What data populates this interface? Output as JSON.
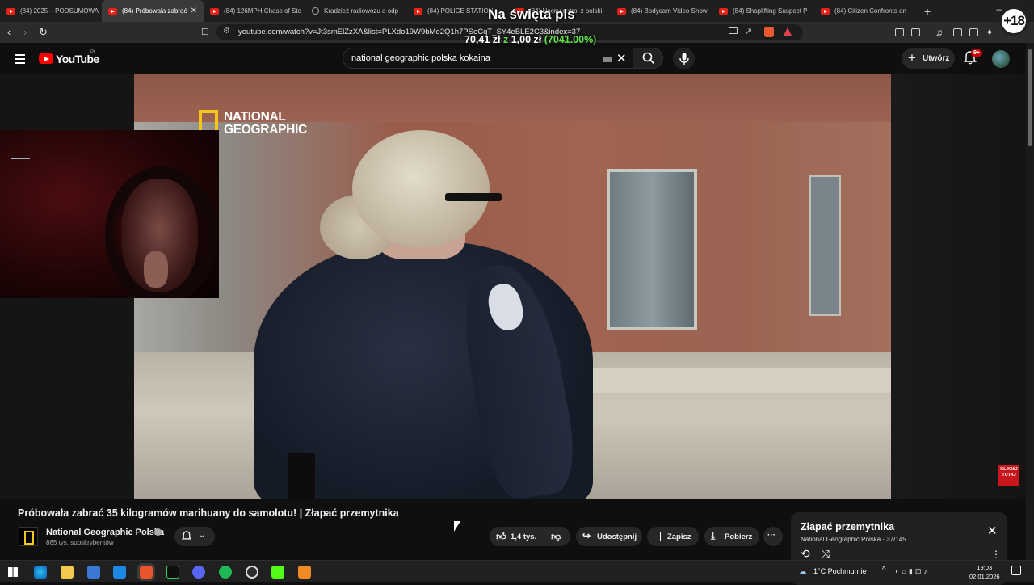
{
  "browser": {
    "tabs": [
      {
        "label": "(84) 2025 – PODSUMOWA",
        "icon": "youtube-icon",
        "active": false
      },
      {
        "label": "(84) Próbowała zabrać",
        "icon": "youtube-icon",
        "active": true
      },
      {
        "label": "(84) 126MPH Chase of Sto",
        "icon": "youtube-icon",
        "active": false
      },
      {
        "label": "Kradzież radiowozu a odp",
        "icon": "globe-icon",
        "active": false
      },
      {
        "label": "(84) POLICE STATION",
        "icon": "youtube-icon",
        "active": false
      },
      {
        "label": "(84) Nocny patrol z polski",
        "icon": "youtube-icon",
        "active": false
      },
      {
        "label": "(84) Bodycam Video Show",
        "icon": "youtube-icon",
        "active": false
      },
      {
        "label": "(84) Shoplifting Suspect P",
        "icon": "youtube-icon",
        "active": false
      },
      {
        "label": "(84) Citizen Confronts an",
        "icon": "youtube-icon",
        "active": false
      }
    ],
    "url": "youtube.com/watch?v=Jt3smElZzXA&list=PLXdo19W9bMe2Q1h7PSeCqT_SY4eBLE2C3&index=37",
    "new_tab_label": "+",
    "minimize_label": "–"
  },
  "overlay": {
    "title": "Na święta pls",
    "amount_prefix": "70,41 zł",
    "amount_from": "z",
    "amount_goal": "1,00 zł",
    "amount_percent": "(7041.00%)",
    "age_badge": "+18"
  },
  "youtube": {
    "logo_text": "YouTube",
    "region": "PL",
    "search_query": "national geographic polska kokaina",
    "create_label": "Utwórz",
    "notif_badge": "9+",
    "watermark_line1": "NATIONAL",
    "watermark_line2": "GEOGRAPHIC",
    "promo_label": "KLIKNIJ TUTAJ",
    "video_title": "Próbowała zabrać 35 kilogramów marihuany do samolotu! | Złapać przemytnika",
    "channel_name": "National Geographic Polska",
    "subscribers": "865 tys. subskrybentów",
    "likes": "1,4 tys.",
    "share_label": "Udostępnij",
    "save_label": "Zapisz",
    "download_label": "Pobierz",
    "more_label": "···",
    "playlist_title": "Złapać przemytnika",
    "playlist_meta": "National Geographic Polska · 37/145"
  },
  "taskbar": {
    "weather": "1°C  Pochmurnie",
    "time": "19:03",
    "date": "02.01.2026"
  }
}
